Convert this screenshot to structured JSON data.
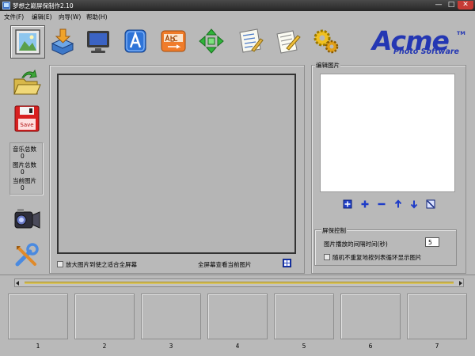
{
  "window": {
    "title": "梦想之巅屏保制作2.10",
    "min_label": "—",
    "max_label": "□",
    "close_label": "✕"
  },
  "menu": [
    "文件(F)",
    "编辑(E)",
    "向导(W)",
    "帮助(H)"
  ],
  "toolbar": {
    "icons": [
      "picture-frame-icon",
      "box-install-icon",
      "monitor-icon",
      "text-a-icon",
      "abc-text-icon",
      "move-arrows-icon",
      "checklist-icon",
      "notes-icon",
      "gears-icon"
    ]
  },
  "logo": {
    "text": "Acme",
    "tm": "TM",
    "subtitle": "Photo Software",
    "color": "#2437b3"
  },
  "sidebar": {
    "icons": [
      "open-folder-icon",
      "save-disk-icon",
      "video-camera-icon",
      "tools-icon"
    ],
    "save_icon_text": "Save",
    "stats": {
      "music_label": "音乐总数",
      "music_count": "0",
      "image_label": "图片总数",
      "image_count": "0",
      "current_label": "当前图片",
      "current_count": "0"
    }
  },
  "preview": {
    "enlarge_label": "放大图片到使之适合全屏幕",
    "fullscreen_label": "全屏幕查看当前图片"
  },
  "edit": {
    "title": "编辑图片",
    "buttons": [
      "add-multiple-icon",
      "add-icon",
      "remove-icon",
      "move-up-icon",
      "move-down-icon",
      "clear-icon"
    ]
  },
  "screensaver": {
    "title": "屏保控制",
    "interval_label": "图片播放的间隔时间(秒)",
    "interval_value": "5",
    "random_label": "随机不重复地按列表循环显示图片"
  },
  "thumbnails": [
    "1",
    "2",
    "3",
    "4",
    "5",
    "6",
    "7"
  ],
  "colors": {
    "accent_blue": "#2437b3",
    "background": "#b9b9b9",
    "close_red": "#c63c36"
  }
}
